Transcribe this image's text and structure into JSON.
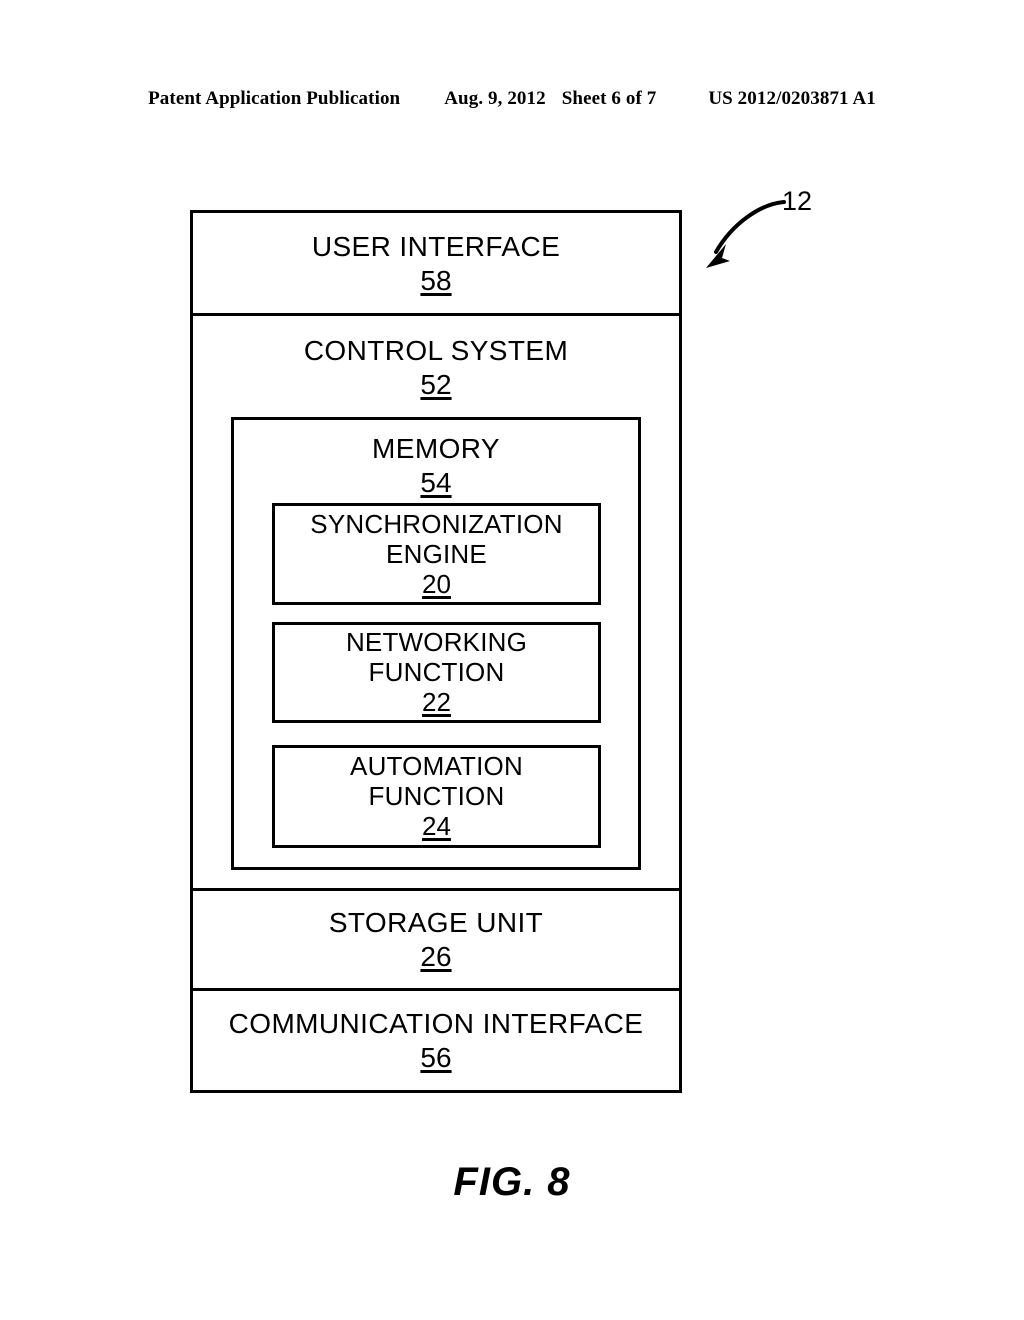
{
  "header": {
    "publication": "Patent Application Publication",
    "date": "Aug. 9, 2012",
    "sheet": "Sheet 6 of 7",
    "number": "US 2012/0203871 A1"
  },
  "figure": {
    "caption": "FIG. 8",
    "callout_ref": "12",
    "blocks": {
      "user_interface": {
        "title": "USER INTERFACE",
        "ref": "58"
      },
      "control_system": {
        "title": "CONTROL SYSTEM",
        "ref": "52"
      },
      "memory": {
        "title": "MEMORY",
        "ref": "54"
      },
      "storage_unit": {
        "title": "STORAGE UNIT",
        "ref": "26"
      },
      "communication_interface": {
        "title": "COMMUNICATION INTERFACE",
        "ref": "56"
      }
    },
    "memory_functions": [
      {
        "line1": "SYNCHRONIZATION",
        "line2": "ENGINE",
        "ref": "20"
      },
      {
        "line1": "NETWORKING",
        "line2": "FUNCTION",
        "ref": "22"
      },
      {
        "line1": "AUTOMATION",
        "line2": "FUNCTION",
        "ref": "24"
      }
    ]
  },
  "colors": {
    "ink": "#000000",
    "paper": "#ffffff"
  }
}
